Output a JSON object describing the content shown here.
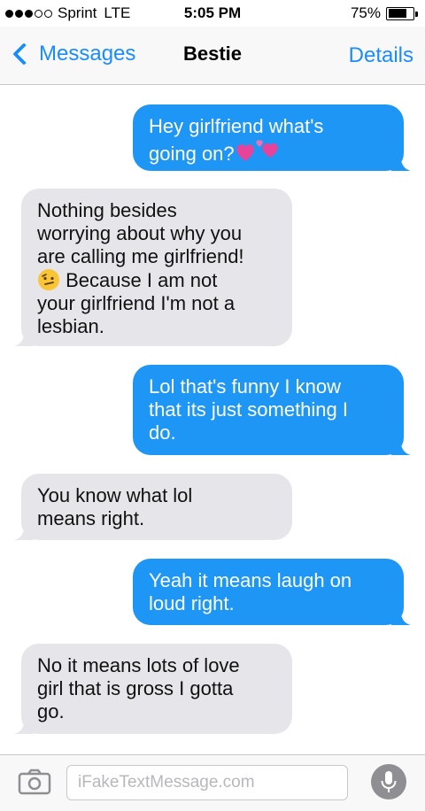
{
  "status_bar": {
    "carrier": "Sprint",
    "network": "LTE",
    "time": "5:05 PM",
    "battery": "75%",
    "battery_level": 0.75,
    "signal_bars": 3,
    "signal_total": 5
  },
  "nav": {
    "back_label": "Messages",
    "title": "Bestie",
    "details_label": "Details"
  },
  "colors": {
    "accent": "#1a8cff",
    "sent_bubble": "#1e96f5",
    "received_bubble": "#e5e5ea"
  },
  "messages": [
    {
      "direction": "sent",
      "lines": [
        "Hey girlfriend what's",
        "going on?"
      ],
      "trailing_emoji": "two-hearts"
    },
    {
      "direction": "received",
      "lines": [
        "Nothing besides",
        "worrying about why you",
        "are calling me girlfriend!",
        "Because I am not",
        "your girlfriend I'm not a",
        "lesbian."
      ],
      "inline_emoji": "confused-face"
    },
    {
      "direction": "sent",
      "lines": [
        "Lol that's funny I know",
        "that its just something I",
        "do."
      ]
    },
    {
      "direction": "received",
      "lines": [
        "You know what lol",
        "means right."
      ]
    },
    {
      "direction": "sent",
      "lines": [
        "Yeah it means laugh on",
        "loud right."
      ]
    },
    {
      "direction": "received",
      "lines": [
        "No it means lots of love",
        "girl that is gross I gotta",
        "go."
      ]
    }
  ],
  "input": {
    "placeholder": "iFakeTextMessage.com"
  }
}
